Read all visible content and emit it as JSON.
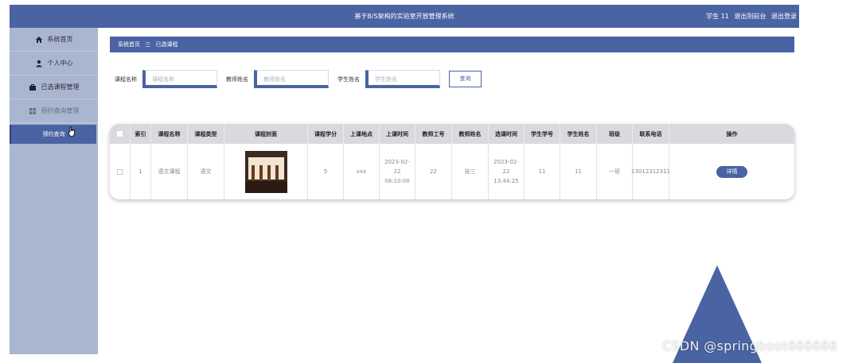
{
  "header": {
    "title": "基于B/S架构的实验室开放管理系统",
    "user": "学生 11",
    "front_link": "退出到前台",
    "logout_link": "退出登录"
  },
  "sidebar": {
    "items": [
      {
        "label": "系统首页",
        "icon": "home-icon"
      },
      {
        "label": "个人中心",
        "icon": "user-icon"
      },
      {
        "label": "已选课程管理",
        "icon": "briefcase-icon"
      },
      {
        "label": "预约查询管理",
        "icon": "grid-icon"
      }
    ],
    "sub_items": [
      {
        "label": "预约查询"
      }
    ]
  },
  "breadcrumb": {
    "home": "系统首页",
    "separator": "三",
    "current": "已选课程"
  },
  "search": {
    "course_label": "课程名称",
    "course_placeholder": "课程名称",
    "teacher_label": "教师姓名",
    "teacher_placeholder": "教师姓名",
    "student_label": "学生姓名",
    "student_placeholder": "学生姓名",
    "query_button": "查询"
  },
  "table": {
    "columns": [
      "索引",
      "课程名称",
      "课程类型",
      "课程封面",
      "课程学分",
      "上课地点",
      "上课时间",
      "教师工号",
      "教师姓名",
      "选课时间",
      "学生学号",
      "学生姓名",
      "班级",
      "联系电话",
      "操作"
    ],
    "rows": [
      {
        "index": "1",
        "course_name": "语文课程",
        "course_type": "语文",
        "credit": "5",
        "location": "xxx",
        "class_time": "2023-02-22 08:10:00",
        "teacher_no": "22",
        "teacher_name": "张三",
        "select_time": "2023-02-22 13:44:25",
        "student_no": "11",
        "student_name": "11",
        "class": "一班",
        "phone": "13012312311",
        "action": "详情"
      }
    ]
  },
  "watermark": "CSDN @springboot666666",
  "colors": {
    "primary": "#4a63a3",
    "sidebar": "#aab5cf",
    "header_row": "#d9d9de"
  }
}
